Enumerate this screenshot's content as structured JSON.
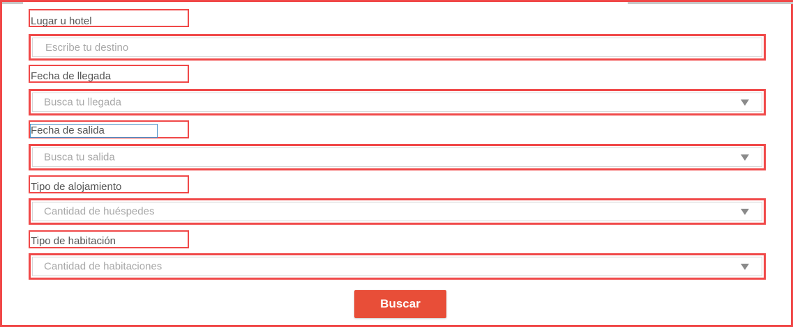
{
  "colors": {
    "highlight_border": "#f04848",
    "button_bg": "#e84e38",
    "button_text": "#ffffff",
    "label_text": "#555555",
    "placeholder_text": "#a8a8a8",
    "focus_outline": "#4a8fc7"
  },
  "form": {
    "location": {
      "label": "Lugar u hotel",
      "placeholder": "Escribe tu destino",
      "value": ""
    },
    "arrival": {
      "label": "Fecha de llegada",
      "placeholder": "Busca tu llegada"
    },
    "departure": {
      "label": "Fecha de salida",
      "placeholder": "Busca tu salida"
    },
    "lodging_type": {
      "label": "Tipo de alojamiento",
      "placeholder": "Cantidad de huéspedes"
    },
    "room_type": {
      "label": "Tipo de habitación",
      "placeholder": "Cantidad de habitaciones"
    },
    "submit_label": "Buscar"
  },
  "icons": {
    "dropdown": "chevron-down-icon"
  }
}
